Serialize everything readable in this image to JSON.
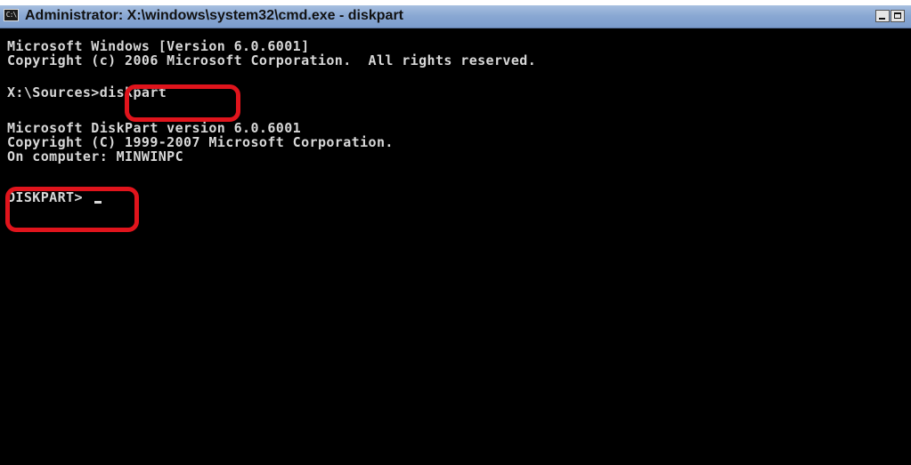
{
  "window": {
    "title": "Administrator: X:\\windows\\system32\\cmd.exe - diskpart",
    "icon": "cmd-icon",
    "icon_glyph": "C:\\"
  },
  "console": {
    "lines": [
      "Microsoft Windows [Version 6.0.6001]",
      "Copyright (c) 2006 Microsoft Corporation.  All rights reserved.",
      "X:\\Sources>diskpart",
      "Microsoft DiskPart version 6.0.6001",
      "Copyright (C) 1999-2007 Microsoft Corporation.",
      "On computer: MINWINPC",
      "DISKPART> "
    ]
  },
  "annotations": {
    "highlight_color": "#e0141c"
  }
}
